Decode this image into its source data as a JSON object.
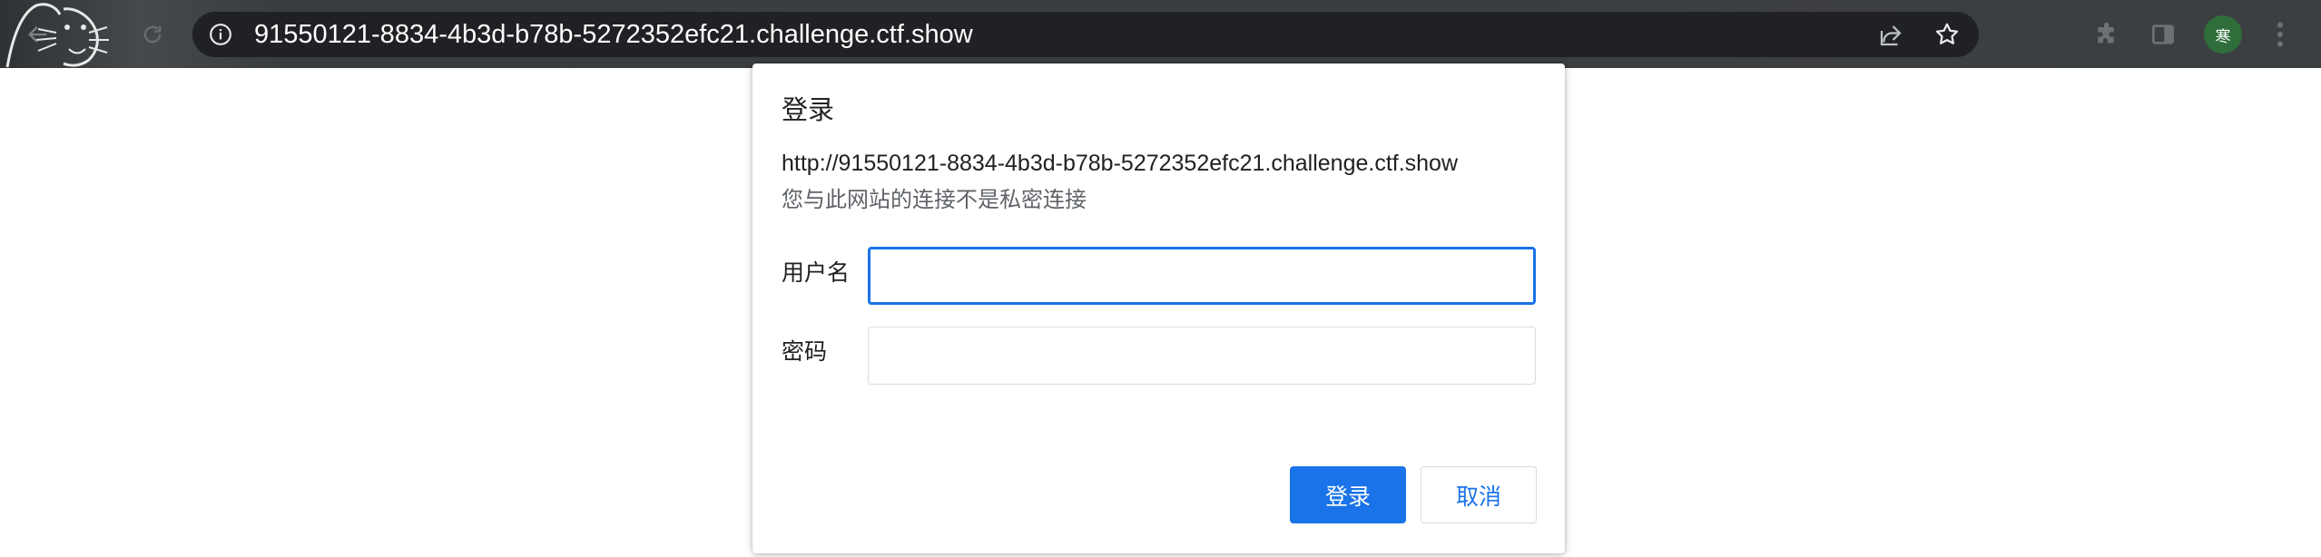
{
  "browser": {
    "url": "91550121-8834-4b3d-b78b-5272352efc21.challenge.ctf.show",
    "profile_initial": "寒",
    "profile_color": "#2f6e3b",
    "icons": {
      "back": "arrow-left-icon",
      "reload": "reload-icon",
      "site_info": "info-icon",
      "share": "share-icon",
      "bookmark": "star-icon",
      "extensions": "puzzle-icon",
      "side_panel": "side-panel-icon",
      "menu": "kebab-menu-icon"
    }
  },
  "dialog": {
    "title": "登录",
    "origin": "http://91550121-8834-4b3d-b78b-5272352efc21.challenge.ctf.show",
    "warning": "您与此网站的连接不是私密连接",
    "username_label": "用户名",
    "username_value": "",
    "password_label": "密码",
    "password_value": "",
    "submit_label": "登录",
    "cancel_label": "取消",
    "accent_color": "#1a73e8"
  }
}
